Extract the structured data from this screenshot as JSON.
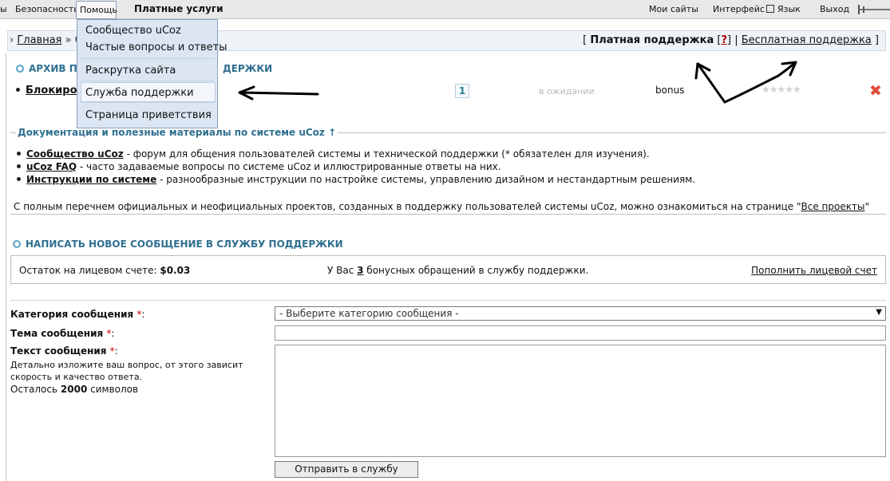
{
  "topbar": {
    "partial": "ы",
    "security": "Безопасность",
    "help": "Помощь",
    "paid": "Платные услуги",
    "my_sites": "Мои сайты",
    "interface": "Интерфейс",
    "language": "Язык",
    "logout": "Выход"
  },
  "menu": {
    "items": [
      "Сообщество uCoz",
      "Частые вопросы и ответы",
      "Раскрутка сайта",
      "Служба поддержки",
      "Страница приветствия"
    ],
    "selected": "Служба поддержки"
  },
  "breadcrumb": {
    "sep1": "›",
    "home": "Главная",
    "sep2": "»",
    "current": "Сл",
    "open_bracket": "[",
    "paid_support": "Платная поддержка",
    "q_open": "[",
    "q": "?",
    "q_close": "]",
    "pipe": "|",
    "free_support": "Бесплатная поддержка",
    "close_bracket": "]"
  },
  "archive": {
    "title_left": "АРХИВ ПЕ",
    "title_right": "ДЕРЖКИ",
    "row": {
      "subject": "Блокиров",
      "count": "1",
      "status": "в ожидании",
      "type": "bonus",
      "stars": "★★★★★",
      "delete": "✖"
    }
  },
  "docs": {
    "heading": "Документация и полезные материалы по системе uCoz ↑",
    "items": [
      {
        "link": "Сообщество uCoz",
        "text": " - форум для общения пользователей системы и технической поддержки (* обязателен для изучения)."
      },
      {
        "link": "uCoz FAQ",
        "text": " - часто задаваемые вопросы по системе uCoz и иллюстрированные ответы на них."
      },
      {
        "link": "Инструкции по системе",
        "text": " - разнообразные инструкции по настройке системы, управлению дизайном и нестандартным решениям."
      }
    ],
    "footer_text": "С полным перечнем официальных и неофициальных проектов, созданных в поддержку пользователей системы uCoz, можно ознакомиться на странице \"",
    "footer_link": "Все проекты",
    "footer_end": "\""
  },
  "new_message": {
    "title": "НАПИСАТЬ НОВОЕ СООБЩЕНИЕ В СЛУЖБУ ПОДДЕРЖКИ"
  },
  "balance": {
    "label": "Остаток на лицевом счете: ",
    "amount": "$0.03",
    "bonus_pre": "У Вас ",
    "bonus_count": "3",
    "bonus_post": " бонусных обращений в службу поддержки.",
    "topup": "Пополнить лицевой счет"
  },
  "form": {
    "category_label": "Категория сообщения ",
    "subject_label": "Тема сообщения ",
    "text_label": "Текст сообщения ",
    "required": "*",
    "colon": ":",
    "hint": "Детально изложите ваш вопрос, от этого зависит скорость и качество ответа.",
    "remaining_pre": "Осталось ",
    "remaining_count": "2000",
    "remaining_post": " символов",
    "category_placeholder": "- Выберите категорию сообщения -",
    "select_arrow": "▼",
    "submit": "Отправить в службу поддержки"
  }
}
